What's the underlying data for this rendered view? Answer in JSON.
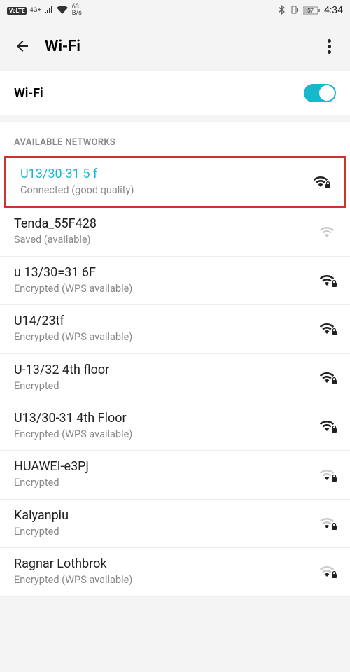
{
  "status_bar": {
    "volte": "VoLTE",
    "net_type": "4G+",
    "bs_value": "63",
    "bs_unit": "B/s",
    "battery": "57",
    "time": "4:34"
  },
  "app_bar": {
    "title": "Wi-Fi"
  },
  "wifi_toggle": {
    "label": "Wi-Fi",
    "on": true
  },
  "section_header": "AVAILABLE NETWORKS",
  "networks": [
    {
      "ssid": "U13/30-31 5 f",
      "status": "Connected (good quality)",
      "connected": true,
      "highlighted": true,
      "strength": "strong",
      "locked": true
    },
    {
      "ssid": "Tenda_55F428",
      "status": "Saved (available)",
      "connected": false,
      "strength": "weak",
      "locked": false
    },
    {
      "ssid": "u 13/30=31 6F",
      "status": "Encrypted (WPS available)",
      "connected": false,
      "strength": "strong",
      "locked": true
    },
    {
      "ssid": "U14/23tf",
      "status": "Encrypted (WPS available)",
      "connected": false,
      "strength": "strong",
      "locked": true
    },
    {
      "ssid": "U-13/32 4th floor",
      "status": "Encrypted",
      "connected": false,
      "strength": "strong",
      "locked": true
    },
    {
      "ssid": "U13/30-31 4th Floor",
      "status": "Encrypted (WPS available)",
      "connected": false,
      "strength": "strong",
      "locked": true
    },
    {
      "ssid": "HUAWEI-e3Pj",
      "status": "Encrypted",
      "connected": false,
      "strength": "med",
      "locked": true
    },
    {
      "ssid": "Kalyanpiu",
      "status": "Encrypted",
      "connected": false,
      "strength": "med",
      "locked": true
    },
    {
      "ssid": "Ragnar Lothbrok",
      "status": "Encrypted (WPS available)",
      "connected": false,
      "strength": "med",
      "locked": true
    }
  ]
}
